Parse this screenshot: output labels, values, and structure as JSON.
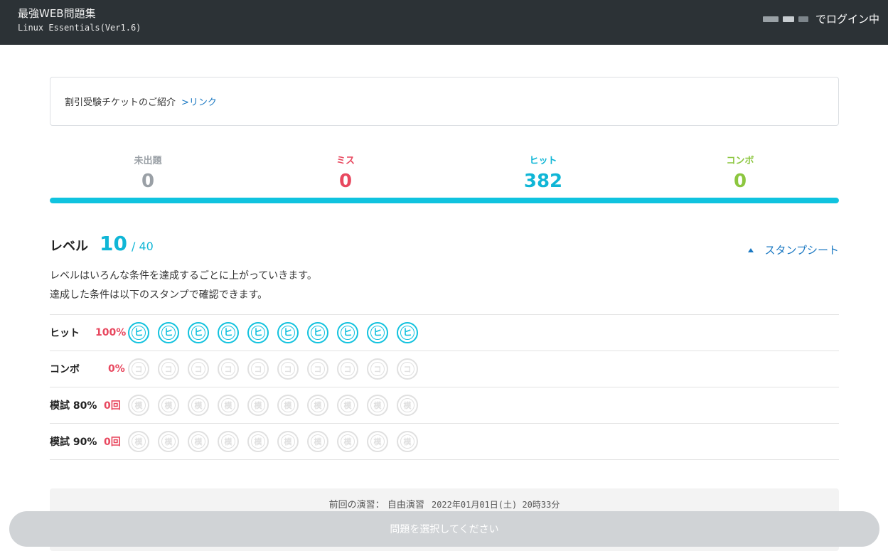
{
  "header": {
    "title": "最強WEB問題集",
    "subtitle": "Linux Essentials(Ver1.6)",
    "login_text": "でログイン中"
  },
  "notice": {
    "text": "割引受験チケットのご紹介",
    "link": ">リンク"
  },
  "stats": [
    {
      "label": "未出題",
      "value": "0",
      "color": "#9aa0a6"
    },
    {
      "label": "ミス",
      "value": "0",
      "color": "#e8485f"
    },
    {
      "label": "ヒット",
      "value": "382",
      "color": "#10b6d6"
    },
    {
      "label": "コンボ",
      "value": "0",
      "color": "#8cc63f"
    }
  ],
  "progress": {
    "fraction": 1.0
  },
  "level": {
    "label": "レベル",
    "value": "10",
    "max": "/ 40",
    "stamp_sheet_link": "スタンプシート",
    "desc_line1": "レベルはいろんな条件を達成するごとに上がっていきます。",
    "desc_line2": "達成した条件は以下のスタンプで確認できます。"
  },
  "stamp_rows": [
    {
      "label": "ヒット",
      "pct": "100%",
      "char": "ヒ",
      "earned": 10,
      "total": 10
    },
    {
      "label": "コンボ",
      "pct": "0%",
      "char": "コ",
      "earned": 0,
      "total": 10
    },
    {
      "label": "模試 80%",
      "pct": "0回",
      "char": "模",
      "earned": 0,
      "total": 10
    },
    {
      "label": "模試 90%",
      "pct": "0回",
      "char": "模",
      "earned": 0,
      "total": 10
    }
  ],
  "last_practice": {
    "label": "前回の演習：",
    "type": "自由演習",
    "datetime": "2022年01月01日(土) 20時33分"
  },
  "bottom_button": "問題を選択してください",
  "colors": {
    "accent": "#10c3df",
    "miss": "#e8485f",
    "combo": "#8cc63f",
    "link": "#1a78c2"
  }
}
